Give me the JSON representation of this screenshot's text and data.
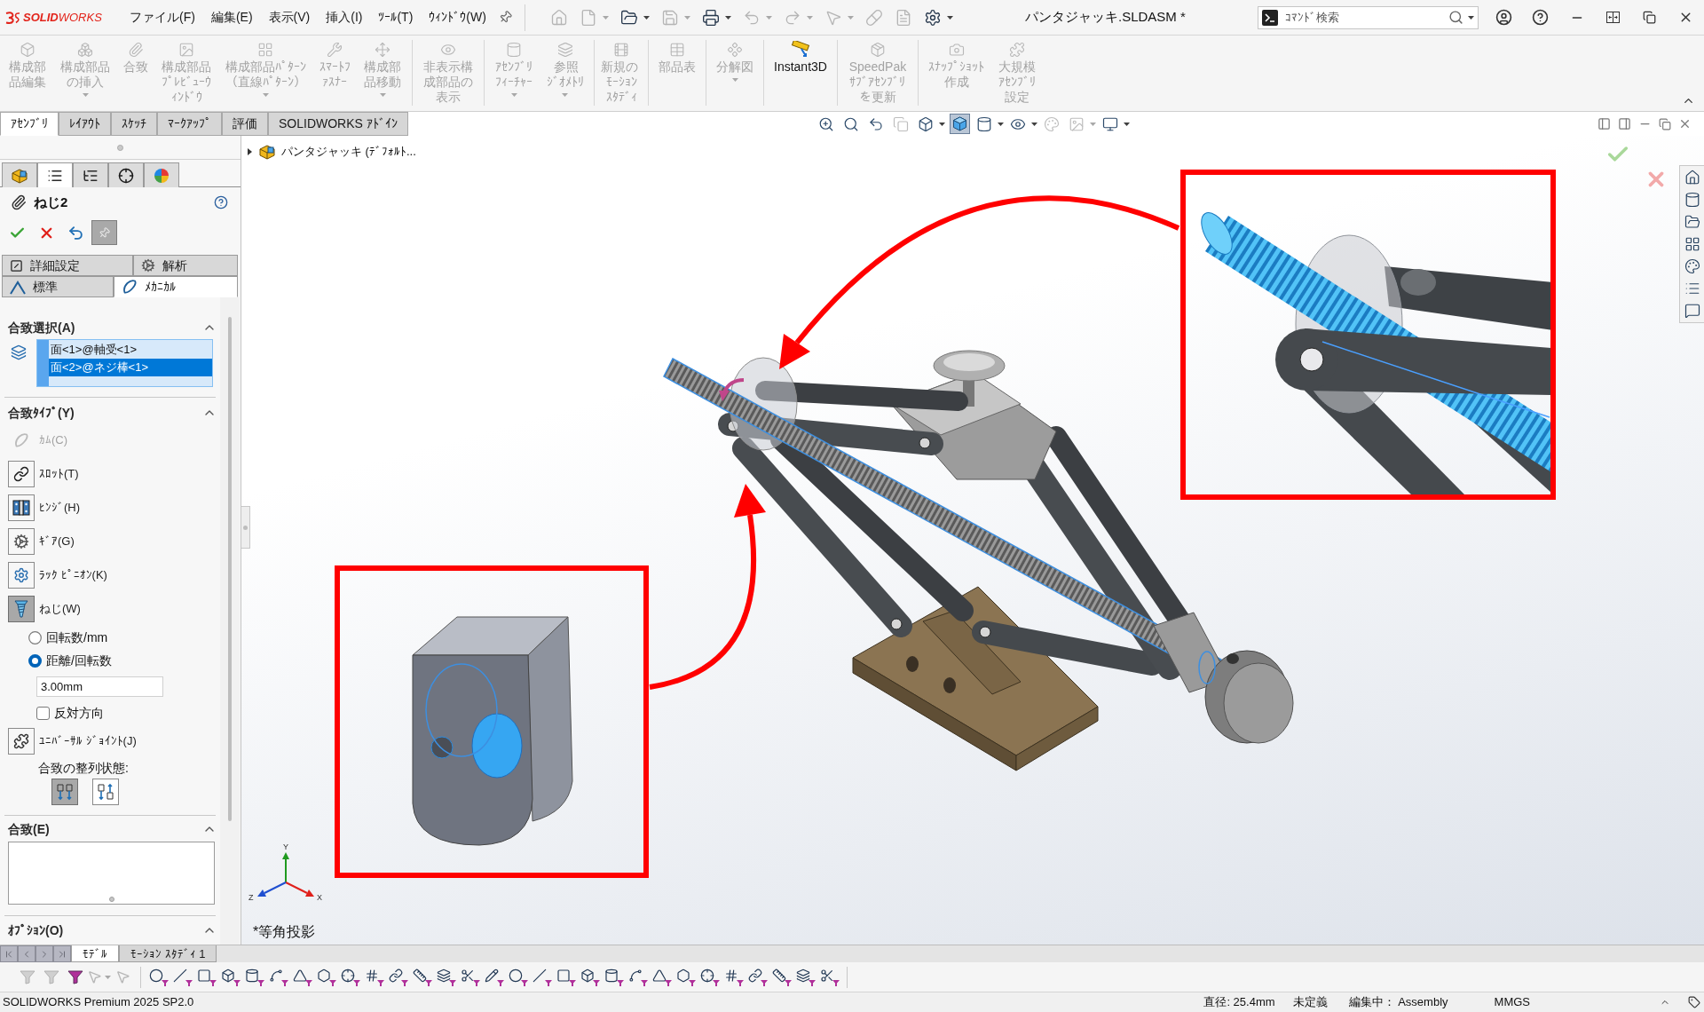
{
  "app": {
    "logo": "**SOLID**WORKS",
    "title": "パンタジャッキ.SLDASM *"
  },
  "menu": [
    "ファイル(F)",
    "編集(E)",
    "表示(V)",
    "挿入(I)",
    "ﾂｰﾙ(T)",
    "ｳｨﾝﾄﾞｳ(W)"
  ],
  "quick_access": [
    {
      "kind": "home",
      "disabled": true,
      "dropdown": false
    },
    {
      "kind": "new",
      "disabled": true,
      "dropdown": true
    },
    {
      "kind": "open",
      "disabled": false,
      "dropdown": true
    },
    {
      "kind": "save",
      "disabled": true,
      "dropdown": true
    },
    {
      "kind": "print",
      "disabled": false,
      "dropdown": true
    },
    {
      "kind": "undo",
      "disabled": true,
      "dropdown": true
    },
    {
      "kind": "redo",
      "disabled": true,
      "dropdown": true
    },
    {
      "kind": "select",
      "disabled": true,
      "dropdown": true
    },
    {
      "kind": "rebuild",
      "disabled": true,
      "dropdown": false
    },
    {
      "kind": "properties",
      "disabled": true,
      "dropdown": false
    },
    {
      "kind": "options",
      "disabled": false,
      "dropdown": true
    }
  ],
  "search": {
    "placeholder": "ｺﾏﾝﾄﾞ検索"
  },
  "ribbon": {
    "expanded": true,
    "groups": [
      {
        "buttons": [
          {
            "kind": "edit-component",
            "label": "構成部品編集",
            "disabled": true,
            "dropdown": false
          },
          {
            "kind": "insert-components",
            "label": "構成部品の挿入",
            "disabled": true,
            "dropdown": true
          },
          {
            "kind": "mate",
            "label": "合致",
            "disabled": true,
            "dropdown": false
          },
          {
            "kind": "preview-window",
            "label": "構成部品ﾌﾟﾚﾋﾞｭｰｳｨﾝﾄﾞｳ",
            "disabled": true,
            "dropdown": false
          },
          {
            "kind": "pattern",
            "label": "構成部品ﾊﾟﾀｰﾝ（直線ﾊﾟﾀｰﾝ）",
            "disabled": true,
            "dropdown": true
          },
          {
            "kind": "smart-fasteners",
            "label": "ｽﾏｰﾄﾌｧｽﾅｰ",
            "disabled": true,
            "dropdown": false
          },
          {
            "kind": "move-component",
            "label": "構成部品移動",
            "disabled": true,
            "dropdown": true
          }
        ]
      },
      {
        "buttons": [
          {
            "kind": "show-hidden",
            "label": "非表示構成部品の表示",
            "disabled": true,
            "dropdown": false
          }
        ]
      },
      {
        "buttons": [
          {
            "kind": "assembly-features",
            "label": "ｱｾﾝﾌﾞﾘﾌｨｰﾁｬｰ",
            "disabled": true,
            "dropdown": true
          },
          {
            "kind": "reference-geometry",
            "label": "参照ｼﾞｵﾒﾄﾘ",
            "disabled": true,
            "dropdown": true
          }
        ]
      },
      {
        "buttons": [
          {
            "kind": "motion-study",
            "label": "新規のﾓｰｼｮﾝｽﾀﾃﾞｨ",
            "disabled": true,
            "dropdown": false
          }
        ]
      },
      {
        "buttons": [
          {
            "kind": "bom",
            "label": "部品表",
            "disabled": true,
            "dropdown": false
          }
        ]
      },
      {
        "buttons": [
          {
            "kind": "exploded-view",
            "label": "分解図",
            "disabled": true,
            "dropdown": true
          }
        ]
      },
      {
        "buttons": [
          {
            "kind": "instant3d",
            "label": "Instant3D",
            "disabled": false,
            "dropdown": false
          }
        ]
      },
      {
        "buttons": [
          {
            "kind": "speedpak",
            "label": "SpeedPakｻﾌﾞｱｾﾝﾌﾞﾘを更新",
            "disabled": true,
            "dropdown": false
          }
        ]
      },
      {
        "buttons": [
          {
            "kind": "snapshot",
            "label": "ｽﾅｯﾌﾟｼｮｯﾄ作成",
            "disabled": true,
            "dropdown": false
          },
          {
            "kind": "large-assembly",
            "label": "大規模ｱｾﾝﾌﾞﾘ設定",
            "disabled": true,
            "dropdown": false
          }
        ]
      }
    ]
  },
  "command_tabs": [
    {
      "label": "ｱｾﾝﾌﾞﾘ",
      "selected": true
    },
    {
      "label": "ﾚｲｱｳﾄ",
      "selected": false
    },
    {
      "label": "ｽｹｯﾁ",
      "selected": false
    },
    {
      "label": "ﾏｰｸｱｯﾌﾟ",
      "selected": false
    },
    {
      "label": "評価",
      "selected": false
    },
    {
      "label": "SOLIDWORKS ｱﾄﾞｲﾝ",
      "selected": false
    }
  ],
  "view_toolbar": [
    {
      "kind": "zoom-fit",
      "selected": false,
      "disabled": false,
      "dropdown": false
    },
    {
      "kind": "zoom-area",
      "selected": false,
      "disabled": false,
      "dropdown": false
    },
    {
      "kind": "previous-view",
      "selected": false,
      "disabled": false,
      "dropdown": false
    },
    {
      "kind": "section-view",
      "selected": false,
      "disabled": true,
      "dropdown": false
    },
    {
      "kind": "view-orientation",
      "selected": false,
      "disabled": false,
      "dropdown": true
    },
    {
      "kind": "display-style",
      "selected": true,
      "disabled": false,
      "dropdown": false
    },
    {
      "kind": "hide-lines",
      "selected": false,
      "disabled": false,
      "dropdown": true
    },
    {
      "kind": "hide-show",
      "selected": false,
      "disabled": false,
      "dropdown": true
    },
    {
      "kind": "appearance",
      "selected": false,
      "disabled": true,
      "dropdown": false
    },
    {
      "kind": "scene",
      "selected": false,
      "disabled": true,
      "dropdown": true
    },
    {
      "kind": "view-settings",
      "selected": false,
      "disabled": false,
      "dropdown": true
    }
  ],
  "panel_tabs": [
    {
      "kind": "feature-tree",
      "selected": false
    },
    {
      "kind": "property-manager",
      "selected": true
    },
    {
      "kind": "configuration",
      "selected": false
    },
    {
      "kind": "dimxpert",
      "selected": false
    },
    {
      "kind": "display",
      "selected": false
    }
  ],
  "property_manager": {
    "title": "ねじ2",
    "option_tabs": [
      {
        "tabs": [
          {
            "kind": "advanced",
            "label": "詳細設定",
            "selected": false
          },
          {
            "kind": "analysis",
            "label": "解析",
            "selected": false
          }
        ]
      },
      {
        "tabs": [
          {
            "kind": "standard",
            "label": "標準",
            "selected": false
          },
          {
            "kind": "mechanical",
            "label": "ﾒｶﾆｶﾙ",
            "selected": true
          }
        ]
      }
    ],
    "mate_selections": {
      "title": "合致選択(A)",
      "expanded": true,
      "items": [
        {
          "label": "面<1>@軸受<1>",
          "selected": false
        },
        {
          "label": "面<2>@ネジ棒<1>",
          "selected": true
        }
      ]
    },
    "mate_types": {
      "title": "合致ﾀｲﾌﾟ(Y)",
      "expanded": true,
      "items": [
        {
          "kind": "cam",
          "label": "ｶﾑ(C)",
          "disabled": true,
          "selected": false
        },
        {
          "kind": "slot",
          "label": "ｽﾛｯﾄ(T)",
          "disabled": false,
          "selected": false
        },
        {
          "kind": "hinge",
          "label": "ﾋﾝｼﾞ(H)",
          "disabled": false,
          "selected": false
        },
        {
          "kind": "gear",
          "label": "ｷﾞｱ(G)",
          "disabled": false,
          "selected": false
        },
        {
          "kind": "rack-pinion",
          "label": "ﾗｯｸ ﾋﾟﾆｵﾝ(K)",
          "disabled": false,
          "selected": false
        },
        {
          "kind": "screw",
          "label": "ねじ(W)",
          "disabled": false,
          "selected": true,
          "options": {
            "modes": [
              {
                "label": "回転数/mm",
                "selected": false
              },
              {
                "label": "距離/回転数",
                "selected": true
              }
            ],
            "value": "3.00mm",
            "reverse": {
              "label": "反対方向",
              "checked": false
            }
          }
        },
        {
          "kind": "universal-joint",
          "label": "ﾕﾆﾊﾞｰｻﾙ ｼﾞｮｲﾝﾄ(J)",
          "disabled": false,
          "selected": false
        }
      ],
      "alignment": {
        "label": "合致の整列状態:",
        "options": [
          {
            "kind": "aligned",
            "selected": true
          },
          {
            "kind": "anti-aligned",
            "selected": false
          }
        ]
      }
    },
    "mates": {
      "title": "合致(E)",
      "expanded": true
    },
    "options": {
      "title": "ｵﾌﾟｼｮﾝ(O)",
      "expanded": true
    }
  },
  "feature_tree": {
    "label": "パンタジャッキ (ﾃﾞﾌｫﾙﾄ...",
    "expanded": false
  },
  "viewport": {
    "view_name": "*等角投影",
    "triad": {
      "y": "Y",
      "z": "Z",
      "x": "X"
    }
  },
  "bottom_tabs": [
    {
      "label": "ﾓﾃﾞﾙ",
      "selected": true
    },
    {
      "label": "ﾓｰｼｮﾝ ｽﾀﾃﾞｨ 1",
      "selected": false
    }
  ],
  "selection_filter_toolbar": [
    {
      "disabled": true
    },
    {
      "disabled": true
    },
    {
      "disabled": false
    },
    {
      "disabled": true
    },
    {
      "disabled": true
    },
    {
      "disabled": false
    },
    {
      "disabled": false
    },
    {
      "disabled": false
    },
    {
      "disabled": false
    },
    {
      "disabled": false
    },
    {
      "disabled": false
    },
    {
      "disabled": false
    },
    {
      "disabled": false
    },
    {
      "disabled": false
    },
    {
      "disabled": false
    },
    {
      "disabled": false
    },
    {
      "disabled": false
    },
    {
      "disabled": false
    },
    {
      "disabled": false
    },
    {
      "disabled": false
    },
    {
      "disabled": false
    },
    {
      "disabled": false
    },
    {
      "disabled": false
    },
    {
      "disabled": false
    },
    {
      "disabled": false
    },
    {
      "disabled": false
    },
    {
      "disabled": false
    },
    {
      "disabled": false
    },
    {
      "disabled": false
    },
    {
      "disabled": false
    },
    {
      "disabled": false
    },
    {
      "disabled": false
    },
    {
      "disabled": false
    },
    {
      "disabled": false
    }
  ],
  "status_bar": {
    "product": "SOLIDWORKS Premium 2025 SP2.0",
    "diameter": "直径: 25.4mm",
    "definition": "未定義",
    "editing": "編集中： Assembly",
    "units": "MMGS"
  }
}
